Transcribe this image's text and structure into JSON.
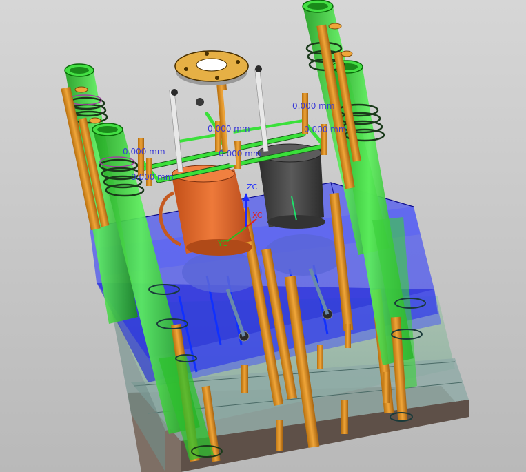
{
  "viewport": {
    "background_top": "#d4d4d4",
    "background_bottom": "#b8b8b8"
  },
  "dimensions": [
    "0.000 mm",
    "0.000 mm",
    "0.000 mm",
    "0.000 mm",
    "0.000 mm",
    "0.000 mm"
  ],
  "triad": {
    "z_label": "ZC",
    "x_label": "XC",
    "y_label": "YC"
  },
  "colors": {
    "mold_blue": "#1e2bff",
    "mold_green": "#2ee02e",
    "pin_orange": "#e3921a",
    "cup_orange": "#e06a2c",
    "cup_dark": "#4a4a4a",
    "base_brown": "#7a6a60",
    "dim_text": "#3a3ad6"
  }
}
